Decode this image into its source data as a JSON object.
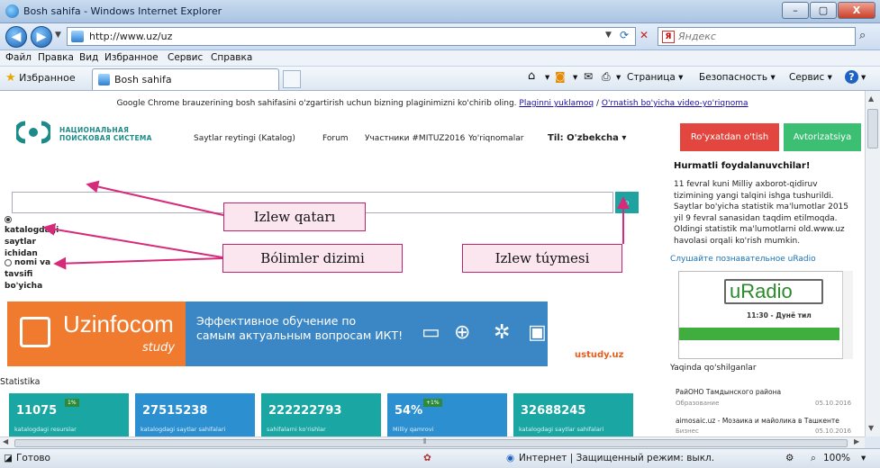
{
  "window": {
    "title": "Bosh sahifa - Windows Internet Explorer",
    "min": "–",
    "max": "▢",
    "close": "X"
  },
  "address_bar": {
    "url": "http://www.uz/uz",
    "search_placeholder": "Яндекс"
  },
  "menu": [
    "Файл",
    "Правка",
    "Вид",
    "Избранное",
    "Сервис",
    "Справка"
  ],
  "favorites_bar": {
    "favorites_label": "Избранное",
    "tab_label": "Bosh sahifa"
  },
  "command_bar": {
    "page": "Страница",
    "safety": "Безопасность",
    "service": "Сервис"
  },
  "page": {
    "notice_text": "Google Chrome brauzerining bosh sahifasini o'zgartirish uchun bizning plaginimizni ko'chirib oling.",
    "notice_link1": "Plaginni yuklamoq",
    "notice_sep": " / ",
    "notice_link2": "O'rnatish bo'yicha video-yo'riqnoma",
    "logo_line1": "НАЦИОНАЛЬНАЯ",
    "logo_line2": "ПОИСКОВАЯ СИСТЕМА",
    "nav": [
      "Saytlar reytingi (Katalog)",
      "Forum",
      "Участники #MITUZ2016",
      "Yo'riqnomalar"
    ],
    "language": "Til: O'zbekcha",
    "register_button": "Ro'yxatdan o'tish",
    "login_button": "Avtorizatsiya",
    "search_option1": [
      "katalogdagi",
      "saytlar",
      "ichidan"
    ],
    "search_option2": [
      "nomi va",
      "tavsifi",
      "bo'yicha"
    ],
    "annotations": {
      "search_field": "Izlew qatarı",
      "sections_list": "Bólimler dizimi",
      "search_button": "Izlew túymesi"
    },
    "banner": {
      "brand": "Uzinfocom",
      "brand_sub": "study",
      "slogan_line1": "Эффективное обучение по",
      "slogan_line2": "самым актуальным вопросам ИКТ!",
      "site": "ustudy.uz"
    },
    "statistics_title": "Statistika",
    "stats": [
      {
        "value": "11075",
        "label": "katalogdagi resurslar",
        "badge": "1%",
        "color": "#1aa6a2"
      },
      {
        "value": "27515238",
        "label": "katalogdagi saytlar sahifalari",
        "badge": "",
        "color": "#2b8fd0"
      },
      {
        "value": "222222793",
        "label": "sahifalarni ko'rishlar",
        "badge": "",
        "color": "#1aa6a2"
      },
      {
        "value": "54%",
        "label": "Milliy qamrovi",
        "badge": "+1%",
        "color": "#2b8fd0"
      },
      {
        "value": "32688245",
        "label": "katalogdagi saytlar sahifalari",
        "badge": "",
        "color": "#1aa6a2"
      }
    ],
    "sidebar": {
      "heading": "Hurmatli foydalanuvchilar!",
      "paragraph": "11 fevral kuni Milliy axborot-qidiruv tizimining yangi talqini ishga tushurildi. Saytlar bo'yicha statistik ma'lumotlar 2015 yil 9 fevral sanasidan taqdim etilmoqda. Oldingi statistik ma'lumotlarni old.www.uz havolasi orqali ko'rish mumkin.",
      "radio_heading": "Слушайте познавательное uRadio",
      "radio_logo": "uRadio",
      "radio_time": "11:30 - Дунё тил",
      "recent_heading": "Yaqinda qo'shilganlar",
      "recent": [
        {
          "title": "РайОНО Тамдынского района",
          "category": "Образование",
          "date": "05.10.2016"
        },
        {
          "title": "aimosaic.uz - Мозаика и майолика в Ташкенте",
          "category": "Бизнес",
          "date": "05.10.2016"
        }
      ]
    }
  },
  "statusbar": {
    "left": "Готово",
    "zone": "Интернет | Защищенный режим: выкл.",
    "zoom": "100%"
  }
}
